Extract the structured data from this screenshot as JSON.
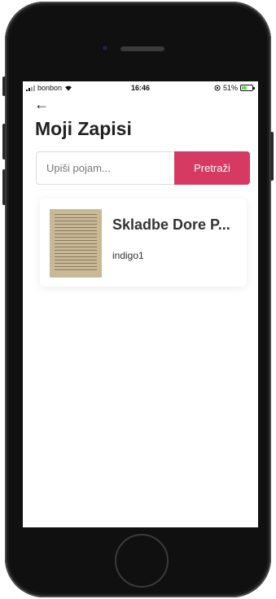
{
  "statusbar": {
    "carrier": "bonbon",
    "time": "16:46",
    "battery": "51%",
    "battery_level": 0.51
  },
  "header": {
    "back_icon": "←",
    "title": "Moji Zapisi"
  },
  "search": {
    "placeholder": "Upiši pojam...",
    "value": "",
    "button_label": "Pretraži"
  },
  "records": [
    {
      "title": "Skladbe Dore P...",
      "subtitle": "indigo1",
      "thumbnail": "sheet-music"
    }
  ],
  "colors": {
    "accent": "#d63a63",
    "battery_fill": "#6ad65a"
  }
}
